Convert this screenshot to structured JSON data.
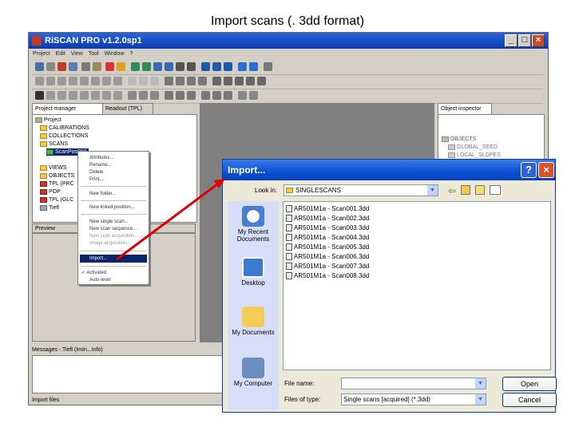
{
  "slide": {
    "title": "Import scans (. 3dd format)"
  },
  "main_window": {
    "title": "RiSCAN PRO v1.2.0sp1",
    "menu": [
      "Project",
      "Edit",
      "View",
      "Tool",
      "Window",
      "?"
    ],
    "project_tabs": [
      "Project manager",
      "Readout (TPL)"
    ],
    "tree": [
      "Project",
      "CALIBRATIONS",
      "COLLECTIONS",
      "SCANS",
      "ScanPos001",
      "VIEWS",
      "OBJECTS",
      "TPL (PRC",
      "POP",
      "TPL (GLC",
      "Tiefl"
    ],
    "preview_label": "Preview",
    "messages_label": "Messages - Tiefl (ImIn...Info)",
    "status_text": "Import files",
    "object_inspector_label": "Object inspector",
    "right_items": [
      "OBJECTS",
      "GLOBAL_SEED",
      "LOCAL_SLOPES"
    ]
  },
  "context_menu": {
    "items": [
      "Attributes...",
      "Rename...",
      "Delete",
      "Print...",
      "New folder...",
      "New linked position...",
      "New single scan...",
      "New scan sequence...",
      "New scan acquisition...",
      "Image acquisition...",
      "Import...",
      "Activated",
      "Auto-level"
    ],
    "highlighted": "Import..."
  },
  "import_dialog": {
    "title": "Import...",
    "look_in_label": "Look in:",
    "look_in_value": "SINGLESCANS",
    "places": [
      "My Recent Documents",
      "Desktop",
      "My Documents",
      "My Computer"
    ],
    "files": [
      "AR501M1a - Scan001.3dd",
      "AR501M1a - Scan002.3dd",
      "AR501M1a - Scan003.3dd",
      "AR501M1a - Scan004.3dd",
      "AR501M1a - Scan005.3dd",
      "AR501M1a - Scan006.3dd",
      "AR501M1a - Scan007.3dd",
      "AR501M1a - Scan008.3dd"
    ],
    "file_name_label": "File name:",
    "file_name_value": "",
    "file_type_label": "Files of type:",
    "file_type_value": "Single scans [acquired] (*.3dd)",
    "open_label": "Open",
    "cancel_label": "Cancel"
  },
  "colors": {
    "arrow": "#e00000",
    "xp_titlebar": "#0b4fd3",
    "highlight": "#0a246a"
  }
}
